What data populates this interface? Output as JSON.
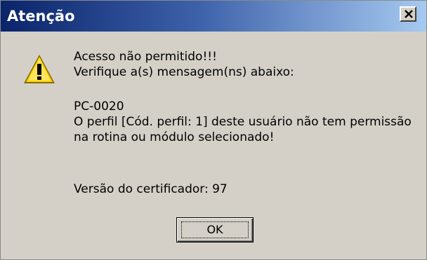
{
  "window": {
    "title": "Atenção",
    "close_icon": "close-icon"
  },
  "dialog": {
    "icon": "warning-icon",
    "message_line1": "Acesso não permitido!!!",
    "message_line2": "Verifique a(s) mensagem(ns) abaixo:",
    "code": "PC-0020",
    "detail_line1": "O perfil [Cód. perfil: 1] deste usuário não tem permissão",
    "detail_line2": "na rotina ou módulo selecionado!",
    "certifier_version": "Versão do certificador: 97",
    "ok_label": "OK"
  },
  "colors": {
    "titlebar_start": "#0a246a",
    "titlebar_end": "#a6caf0",
    "dialog_bg": "#d4d0c8",
    "warning_yellow": "#ffd200"
  }
}
